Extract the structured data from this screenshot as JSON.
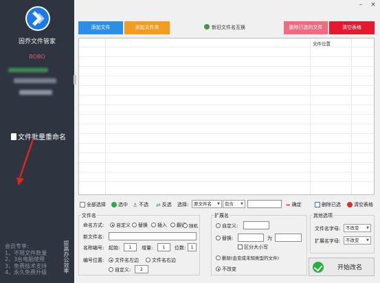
{
  "sidebar": {
    "app_name": "固乔文件管家",
    "user_name": "BOBO",
    "feature_label": "文件批量重命名",
    "member_title": "会员专享:",
    "member_items": [
      "1、不限文件数量",
      "2、3台电脑使用",
      "3、免费技术支持",
      "4、永久免费升级"
    ],
    "vertical_text": "提高办公效率"
  },
  "window": {
    "min": "–",
    "close": "×"
  },
  "toolbar": {
    "add_file": "添加文件",
    "add_folder": "添加文件夹",
    "swap": "新旧文件名互换",
    "delete_selected": "删除已选的文件",
    "clear_table": "清空表格"
  },
  "table": {
    "col_location": "文件位置"
  },
  "actions": {
    "select_all": "全部选择",
    "select": "选中",
    "deselect": "不选",
    "invert": "反选",
    "choose_label": "选择:",
    "choose_field": "原文件名",
    "choose_mode": "包含",
    "choose_value": "",
    "confirm": "确定",
    "delete_selected": "删除已选",
    "clear_table": "清空表格"
  },
  "filename": {
    "title": "文件名",
    "method_label": "命名方式:",
    "opt_custom": "自定义",
    "opt_replace": "替换",
    "opt_insert": "插入",
    "opt_translate": "翻译",
    "opt_random": "随机",
    "new_name_label": "新文件名:",
    "new_name_value": "",
    "number_label": "名称编号:",
    "start_label": "起始:",
    "start_value": "1",
    "step_label": "增量:",
    "step_value": "1",
    "digits_label": "位数:",
    "digits_value": "1",
    "pos_label": "编号位置:",
    "pos_left": "文件名左边",
    "pos_right": "文件名右边",
    "pos_custom": "自定义:",
    "pos_custom_value": "2"
  },
  "extension": {
    "title": "扩展名",
    "custom": "自定义:",
    "custom_value": "",
    "replace": "替换:",
    "replace_from": "",
    "to": "为",
    "replace_to": "",
    "case": "区分大小写",
    "delete": "删除(会变成未知类型的文件)",
    "no_change": "不改变"
  },
  "other": {
    "title": "其他选项",
    "filename_case_label": "文件名字母:",
    "filename_case_value": "不改变",
    "ext_case_label": "扩展名字母:",
    "ext_case_value": "不改变"
  },
  "start_button": "开始改名",
  "colors": {
    "sidebar": "#2f3441",
    "blue": "#2b8ee8",
    "orange": "#f39c20",
    "pink": "#ef6b7d",
    "red": "#e8172f",
    "green": "#27ae3f"
  }
}
